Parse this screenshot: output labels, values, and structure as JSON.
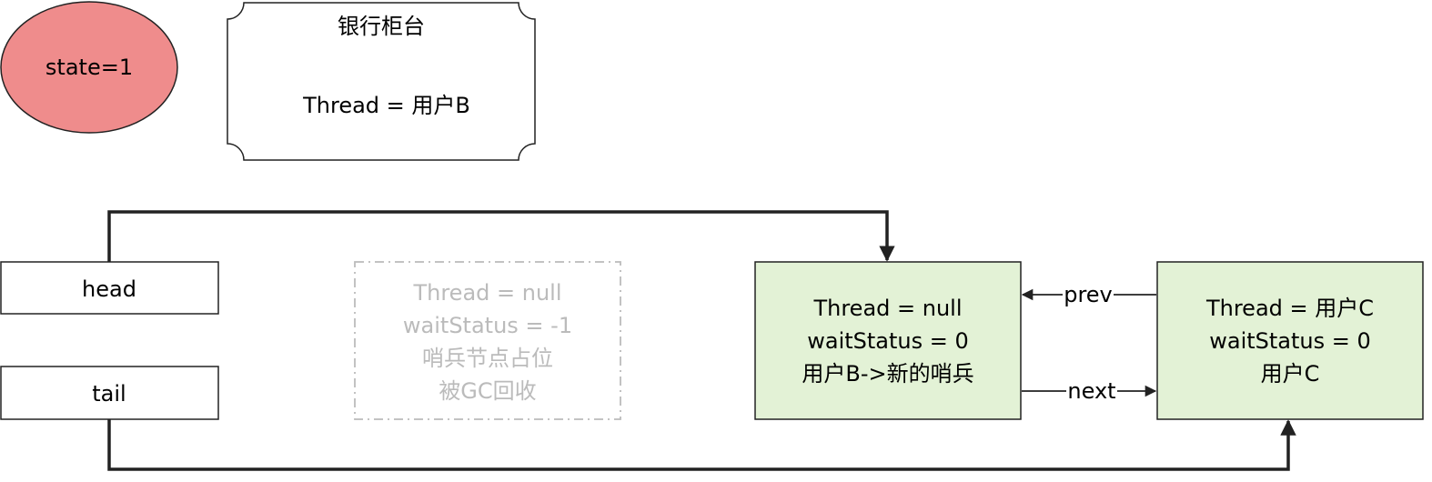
{
  "state": {
    "text": "state=1",
    "fill": "#ef8c8c"
  },
  "counter": {
    "title": "银行柜台",
    "thread": "Thread = 用户B"
  },
  "head": {
    "label": "head"
  },
  "tail": {
    "label": "tail"
  },
  "sentinel": {
    "line1": "Thread = null",
    "line2": "waitStatus = -1",
    "line3": "哨兵节点占位",
    "line4": "被GC回收",
    "color": "#bbbbbb"
  },
  "node_b": {
    "line1": "Thread = null",
    "line2": "waitStatus = 0",
    "line3": "用户B->新的哨兵",
    "fill": "#e3f2d6"
  },
  "node_c": {
    "line1": "Thread = 用户C",
    "line2": "waitStatus = 0",
    "line3": "用户C",
    "fill": "#e3f2d6"
  },
  "edges": {
    "prev": "prev",
    "next": "next"
  }
}
